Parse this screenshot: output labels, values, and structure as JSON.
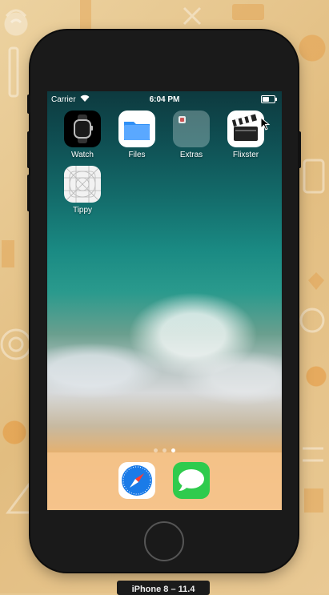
{
  "status_bar": {
    "carrier": "Carrier",
    "time": "6:04 PM",
    "battery_level": 0.6
  },
  "home_screen": {
    "apps": [
      {
        "label": "Watch",
        "icon": "watch-icon"
      },
      {
        "label": "Files",
        "icon": "folder-icon"
      },
      {
        "label": "Extras",
        "icon": "app-folder-icon"
      },
      {
        "label": "Flixster",
        "icon": "clapperboard-icon"
      },
      {
        "label": "Tippy",
        "icon": "app-grid-icon"
      }
    ],
    "page_count": 3,
    "active_page": 3
  },
  "dock": {
    "apps": [
      {
        "label": "Safari",
        "icon": "compass-icon"
      },
      {
        "label": "Messages",
        "icon": "speech-bubble-icon"
      }
    ]
  },
  "simulator": {
    "device_label": "iPhone 8 – 11.4"
  },
  "colors": {
    "files_blue": "#2f8ff6",
    "messages_green": "#2fcb4d",
    "safari_blue": "#1a7be8",
    "device_frame": "#1a1a1a"
  }
}
